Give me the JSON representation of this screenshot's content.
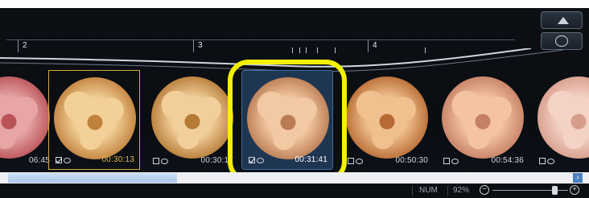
{
  "timeline": {
    "labels": [
      "2",
      "3",
      "4"
    ]
  },
  "thumbnails": [
    {
      "time": "06:45",
      "checked": false,
      "palette": [
        "#e7a5a6",
        "#b95357"
      ]
    },
    {
      "time": "00:30:13",
      "checked": true,
      "palette": [
        "#f3d098",
        "#c0813c"
      ]
    },
    {
      "time": "00:30:17",
      "checked": false,
      "palette": [
        "#f2cf9a",
        "#b57a36"
      ]
    },
    {
      "time": "00:31:41",
      "checked": true,
      "palette": [
        "#f3c9a4",
        "#ba7c52"
      ]
    },
    {
      "time": "00:50:30",
      "checked": false,
      "palette": [
        "#f0c08f",
        "#b76b33"
      ]
    },
    {
      "time": "00:54:36",
      "checked": false,
      "palette": [
        "#f3c3a2",
        "#c47f64"
      ]
    },
    {
      "time": "",
      "checked": false,
      "palette": [
        "#f4d2c6",
        "#d79d8b"
      ]
    }
  ],
  "statusbar": {
    "num": "NUM",
    "zoom": "92%"
  },
  "colors": {
    "highlight_ring": "#f4f000",
    "selected_orange": "#d6a93b",
    "selected_blue": "#1f3652"
  }
}
